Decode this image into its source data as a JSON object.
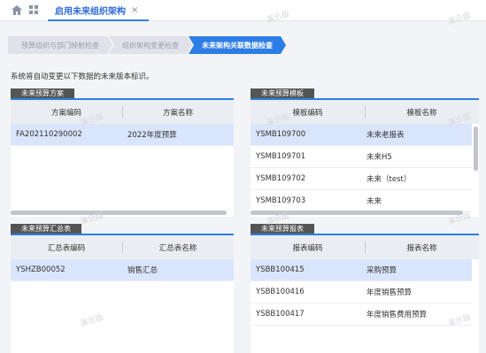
{
  "topbar": {
    "tab_label": "启用未来组织架构",
    "tab_close": "×"
  },
  "steps": [
    {
      "label": "预算组织与部门映射检查"
    },
    {
      "label": "组织架构变更检查"
    },
    {
      "label": "未来架构关联数据检查"
    }
  ],
  "notice": "系统将自动变更以下数据的未来版本标识。",
  "panels": {
    "plan": {
      "title": "未来预算方案",
      "columns": [
        "方案编码",
        "方案名称"
      ],
      "rows": [
        [
          "FA202110290002",
          "2022年度预算"
        ]
      ]
    },
    "template": {
      "title": "未来预算模板",
      "columns": [
        "模板编码",
        "模板名称"
      ],
      "rows": [
        [
          "YSMB109700",
          "未来老报表"
        ],
        [
          "YSMB109701",
          "未来H5"
        ],
        [
          "YSMB109702",
          "未来（test）"
        ],
        [
          "YSMB109703",
          "未来"
        ]
      ]
    },
    "summary": {
      "title": "未来预算汇总表",
      "columns": [
        "汇总表编码",
        "汇总表名称"
      ],
      "rows": [
        [
          "YSHZB00052",
          "销售汇总"
        ]
      ]
    },
    "report": {
      "title": "未来预算报表",
      "columns": [
        "报表编码",
        "报表名称"
      ],
      "rows": [
        [
          "YSBB100415",
          "采购预算"
        ],
        [
          "YSBB100416",
          "年度销售预算"
        ],
        [
          "YSBB100417",
          "年度销售费用预算"
        ]
      ]
    }
  },
  "watermark": "演示版"
}
